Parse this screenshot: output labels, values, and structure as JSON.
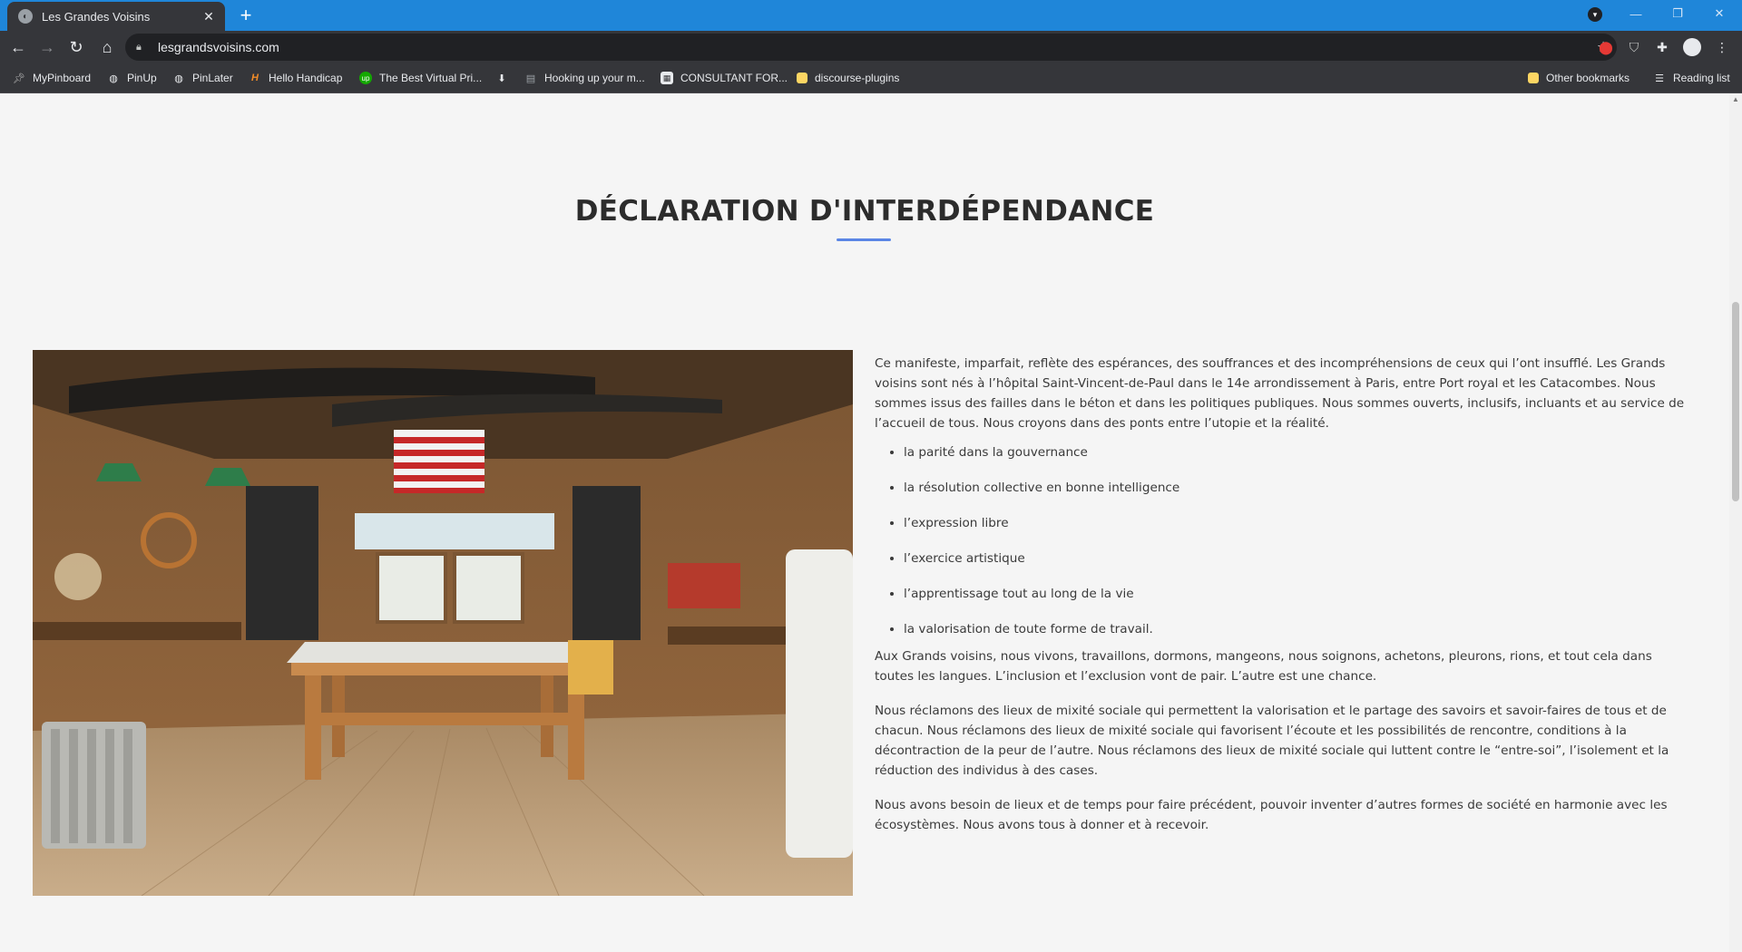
{
  "browser": {
    "tab_title": "Les Grandes Voisins",
    "url": "lesgrandsvoisins.com",
    "bookmarks": [
      {
        "label": "MyPinboard",
        "icon": "pin-icon"
      },
      {
        "label": "PinUp",
        "icon": "globe-icon"
      },
      {
        "label": "PinLater",
        "icon": "globe-icon"
      },
      {
        "label": "Hello Handicap",
        "icon": "h-logo-icon"
      },
      {
        "label": "The Best Virtual Pri...",
        "icon": "upwork-icon"
      },
      {
        "label": "",
        "icon": "download-icon"
      },
      {
        "label": "Hooking up your m...",
        "icon": "page-icon"
      },
      {
        "label": "CONSULTANT FOR...",
        "icon": "qr-icon"
      },
      {
        "label": "discourse-plugins",
        "icon": "folder-icon"
      }
    ],
    "other_bookmarks": "Other bookmarks",
    "reading_list": "Reading list"
  },
  "page": {
    "heading": "DÉCLARATION D'INTERDÉPENDANCE",
    "intro": "Ce manifeste, imparfait, reflète des espérances, des souffrances et des incompréhensions de ceux qui l’ont insufflé. Les Grands voisins sont nés à l’hôpital Saint-Vincent-de-Paul dans le 14e arrondissement à Paris, entre Port royal et les Catacombes. Nous sommes issus des failles dans le béton et dans les politiques publiques. Nous sommes ouverts, inclusifs, incluants et au service de l’accueil de tous. Nous croyons dans des ponts entre l’utopie et la réalité.",
    "values": [
      "la parité dans la gouvernance",
      "la résolution collective en bonne intelligence",
      "l’expression libre",
      "l’exercice artistique",
      "l’apprentissage tout au long de la vie",
      "la valorisation de toute forme de travail."
    ],
    "para2": "Aux Grands voisins, nous vivons, travaillons, dormons, mangeons, nous soignons, achetons, pleurons, rions, et tout cela dans toutes les langues. L’inclusion et l’exclusion vont de pair. L’autre est une chance.",
    "para3": "Nous réclamons des lieux de mixité sociale qui permettent la valorisation et le partage des savoirs et savoir-faires de tous et de chacun. Nous réclamons des lieux de mixité sociale qui favorisent l’écoute et les possibilités de rencontre, conditions à la décontraction de la peur de l’autre. Nous réclamons des lieux de mixité sociale qui luttent contre le “entre-soi”, l’isolement et la réduction des individus à des cases.",
    "para4": "Nous avons besoin de lieux et de temps pour faire précédent, pouvoir inventer d’autres formes de société en harmonie avec les écosystèmes. Nous avons tous à donner et à recevoir."
  },
  "colors": {
    "tabbar": "#1f86d9",
    "chrome": "#35363a",
    "accent_rule": "#5b86e5",
    "heading": "#2c2c2c",
    "body_text": "#3a3a3a"
  }
}
